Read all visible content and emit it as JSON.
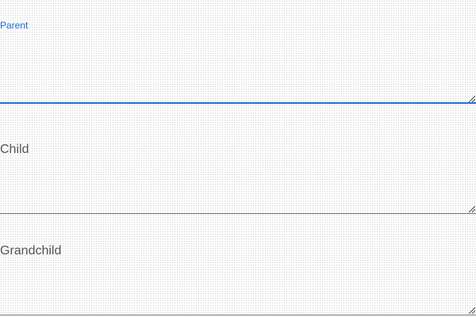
{
  "fields": [
    {
      "label": "Parent",
      "value": "",
      "state": "focused"
    },
    {
      "label": "Child",
      "value": "",
      "state": "idle"
    },
    {
      "label": "Grandchild",
      "value": "",
      "state": "idle"
    }
  ],
  "colors": {
    "focus_accent": "#1e6bd6",
    "idle_label": "#555555",
    "idle_underline": "#777777"
  },
  "icons": {
    "resize_handle": "resize-grip-icon"
  }
}
